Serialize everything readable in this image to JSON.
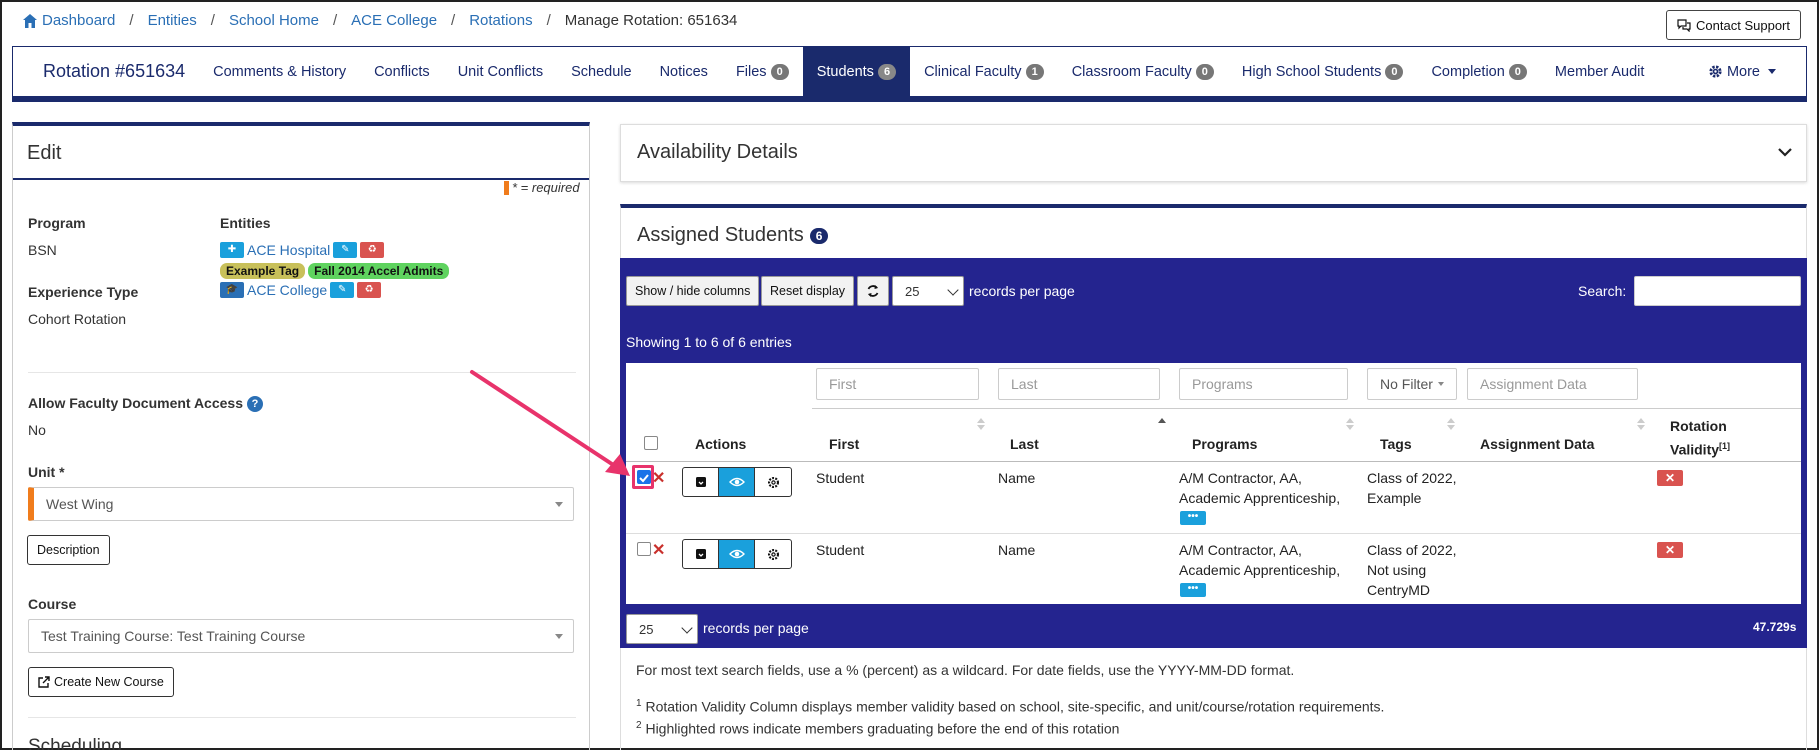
{
  "breadcrumb": {
    "items": [
      "Dashboard",
      "Entities",
      "School Home",
      "ACE College",
      "Rotations"
    ],
    "current": "Manage Rotation: 651634"
  },
  "support": {
    "label": "Contact Support"
  },
  "nav": {
    "brand": "Rotation #651634",
    "items": [
      {
        "label": "Comments & History"
      },
      {
        "label": "Conflicts"
      },
      {
        "label": "Unit Conflicts"
      },
      {
        "label": "Schedule"
      },
      {
        "label": "Notices"
      },
      {
        "label": "Files",
        "badge": "0"
      },
      {
        "label": "Students",
        "badge": "6"
      },
      {
        "label": "Clinical Faculty",
        "badge": "1"
      },
      {
        "label": "Classroom Faculty",
        "badge": "0"
      },
      {
        "label": "High School Students",
        "badge": "0"
      },
      {
        "label": "Completion",
        "badge": "0"
      },
      {
        "label": "Member Audit"
      }
    ],
    "more": "More"
  },
  "edit": {
    "title": "Edit",
    "required_note": "* = required",
    "program_label": "Program",
    "program_value": "BSN",
    "entities_label": "Entities",
    "entity1": "ACE Hospital",
    "tag1": "Example Tag",
    "tag2": "Fall 2014 Accel Admits",
    "entity2": "ACE College",
    "exp_label": "Experience Type",
    "exp_value": "Cohort Rotation",
    "fda_label": "Allow Faculty Document Access",
    "fda_help": "?",
    "fda_value": "No",
    "unit_label": "Unit *",
    "unit_value": "West Wing",
    "desc_btn": "Description",
    "course_label": "Course",
    "course_value": "Test Training Course: Test Training Course",
    "create_course": "Create New Course",
    "scheduling": "Scheduling"
  },
  "availability": {
    "title": "Availability Details"
  },
  "students": {
    "title": "Assigned Students",
    "count": "6",
    "show_hide": "Show / hide columns",
    "reset": "Reset display",
    "per_page": "25",
    "per_page_text": "records per page",
    "search_label": "Search:",
    "showing": "Showing 1 to 6 of 6 entries",
    "filters": {
      "first": "First",
      "last": "Last",
      "programs": "Programs",
      "tags": "No Filter",
      "assignment": "Assignment Data"
    },
    "headers": {
      "actions": "Actions",
      "first": "First",
      "last": "Last",
      "programs": "Programs",
      "tags": "Tags",
      "assignment": "Assignment Data",
      "validity": "Rotation Validity",
      "validity_sup": "[1]"
    },
    "rows": [
      {
        "first": "Student",
        "last": "Name",
        "programs1": "A/M Contractor, AA,",
        "programs2": "Academic Apprenticeship,",
        "tags1": "Class of 2022,",
        "tags2": "Example",
        "tags3": "",
        "checked": true
      },
      {
        "first": "Student",
        "last": "Name",
        "programs1": "A/M Contractor, AA,",
        "programs2": "Academic Apprenticeship,",
        "tags1": "Class of 2022,",
        "tags2": "Not using",
        "tags3": "CentryMD",
        "checked": false
      }
    ],
    "more_dots": "•••",
    "timing": "47.729s",
    "note1": "For most text search fields, use a % (percent) as a wildcard. For date fields, use the YYYY-MM-DD format.",
    "note2_sup": "1",
    "note2": "Rotation Validity Column displays member validity based on school, site-specific, and unit/course/rotation requirements.",
    "note3_sup": "2",
    "note3": "Highlighted rows indicate members graduating before the end of this rotation"
  },
  "colors": {
    "navy": "#1a2a6c",
    "table_bg": "#24248f",
    "info": "#1aa0dc",
    "danger": "#d9534f",
    "accent": "#f07c1c",
    "annotation": "#e8336b"
  }
}
